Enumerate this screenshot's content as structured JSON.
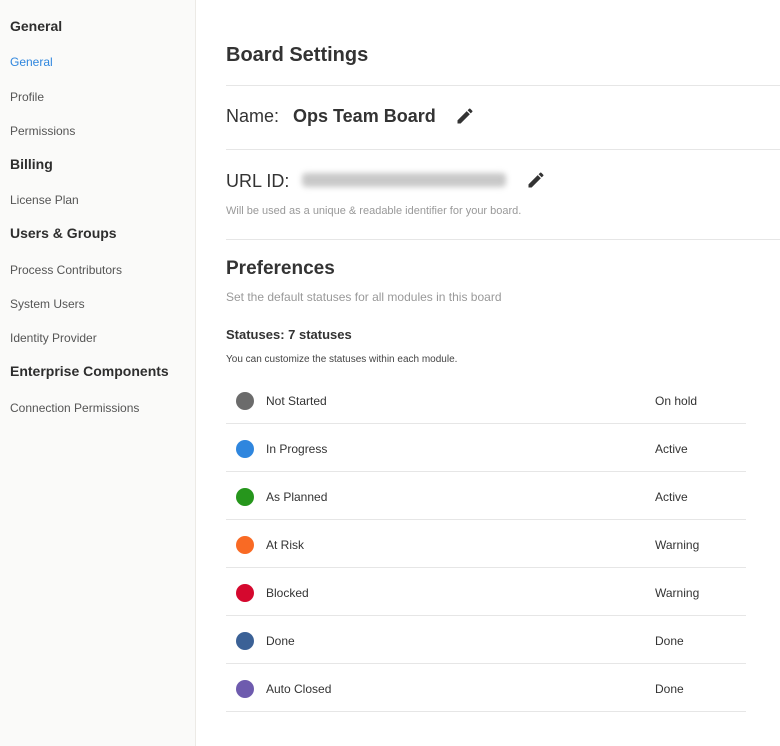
{
  "sidebar": {
    "sections": [
      {
        "title": "General",
        "items": [
          "General",
          "Profile",
          "Permissions"
        ]
      },
      {
        "title": "Billing",
        "items": [
          "License Plan"
        ]
      },
      {
        "title": "Users & Groups",
        "items": [
          "Process Contributors",
          "System Users",
          "Identity Provider"
        ]
      },
      {
        "title": "Enterprise Components",
        "items": [
          "Connection Permissions"
        ]
      }
    ],
    "active": "General",
    "active_color": "#2f86de"
  },
  "main": {
    "title": "Board Settings",
    "name_label": "Name:",
    "name_value": "Ops Team Board",
    "url_label": "URL ID:",
    "url_help": "Will be used as a unique & readable identifier for your board.",
    "preferences_title": "Preferences",
    "preferences_sub": "Set the default statuses for all modules in this board",
    "statuses_heading": "Statuses: 7 statuses",
    "statuses_note": "You can customize the statuses within each module.",
    "statuses": [
      {
        "name": "Not Started",
        "category": "On hold",
        "color": "#6b6b6b"
      },
      {
        "name": "In Progress",
        "category": "Active",
        "color": "#2f86de"
      },
      {
        "name": "As Planned",
        "category": "Active",
        "color": "#26961c"
      },
      {
        "name": "At Risk",
        "category": "Warning",
        "color": "#f96a24"
      },
      {
        "name": "Blocked",
        "category": "Warning",
        "color": "#d5082e"
      },
      {
        "name": "Done",
        "category": "Done",
        "color": "#3b6196"
      },
      {
        "name": "Auto Closed",
        "category": "Done",
        "color": "#6e5bae"
      }
    ]
  }
}
